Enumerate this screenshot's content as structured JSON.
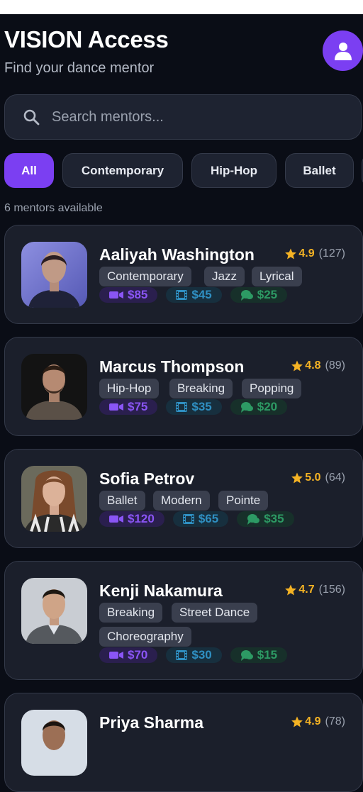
{
  "header": {
    "title": "VISION Access",
    "subtitle": "Find your dance mentor"
  },
  "search": {
    "placeholder": "Search mentors..."
  },
  "filters": [
    "All",
    "Contemporary",
    "Hip-Hop",
    "Ballet"
  ],
  "active_filter": "All",
  "count_text": "6 mentors available",
  "colors": {
    "accent": "#7b3ff2",
    "star": "#f5b324",
    "video": "#8a55f5",
    "film": "#2f8fc2",
    "chat": "#2d9a64"
  },
  "mentors": [
    {
      "name": "Aaliyah Washington",
      "rating": "4.9",
      "reviews": "(127)",
      "tags": [
        "Contemporary",
        "Jazz",
        "Lyrical"
      ],
      "video_price": "$85",
      "film_price": "$45",
      "chat_price": "$25"
    },
    {
      "name": "Marcus Thompson",
      "rating": "4.8",
      "reviews": "(89)",
      "tags": [
        "Hip-Hop",
        "Breaking",
        "Popping"
      ],
      "video_price": "$75",
      "film_price": "$35",
      "chat_price": "$20"
    },
    {
      "name": "Sofia Petrov",
      "rating": "5.0",
      "reviews": "(64)",
      "tags": [
        "Ballet",
        "Modern",
        "Pointe"
      ],
      "video_price": "$120",
      "film_price": "$65",
      "chat_price": "$35"
    },
    {
      "name": "Kenji Nakamura",
      "rating": "4.7",
      "reviews": "(156)",
      "tags": [
        "Breaking",
        "Street Dance",
        "Choreography"
      ],
      "video_price": "$70",
      "film_price": "$30",
      "chat_price": "$15"
    },
    {
      "name": "Priya Sharma",
      "rating": "4.9",
      "reviews": "(78)"
    }
  ]
}
